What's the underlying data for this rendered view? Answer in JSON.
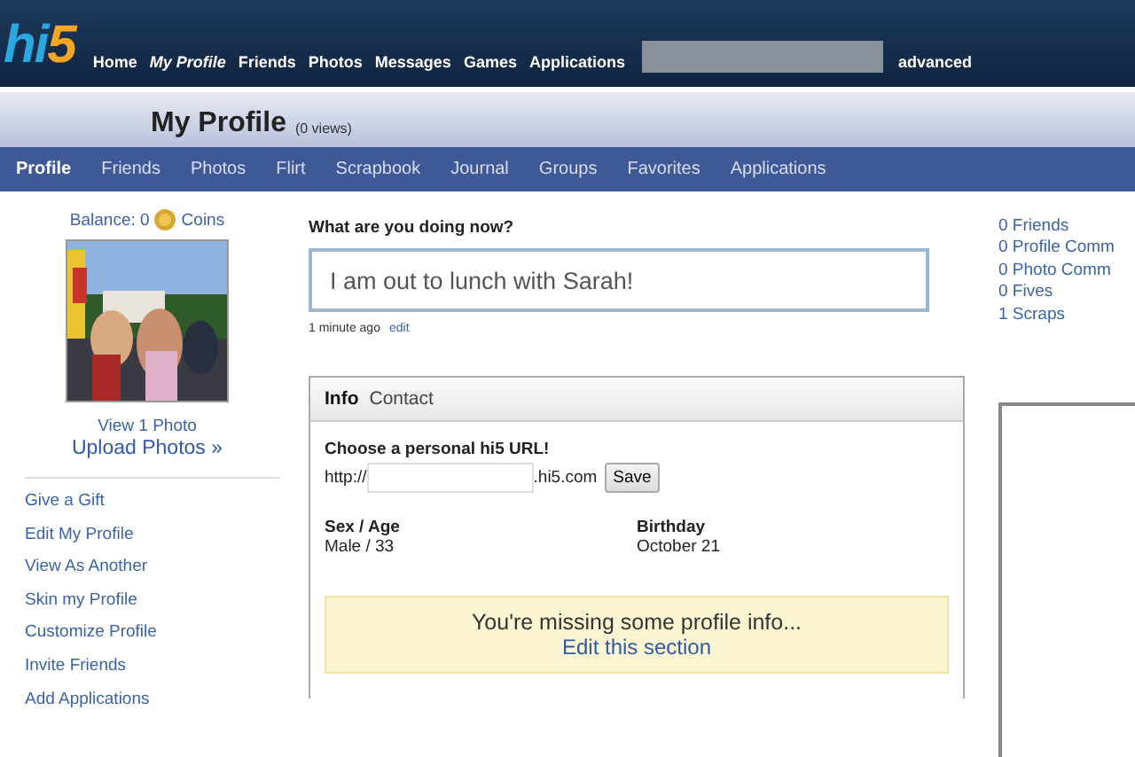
{
  "logo": {
    "part1": "hi",
    "part2": "5"
  },
  "top_nav": [
    {
      "label": "Home",
      "selected": false
    },
    {
      "label": "My Profile",
      "selected": true
    },
    {
      "label": "Friends",
      "selected": false
    },
    {
      "label": "Photos",
      "selected": false
    },
    {
      "label": "Messages",
      "selected": false
    },
    {
      "label": "Games",
      "selected": false
    },
    {
      "label": "Applications",
      "selected": false
    }
  ],
  "search": {
    "advanced": "advanced"
  },
  "header": {
    "title": "My Profile",
    "views": "(0 views)"
  },
  "profile_nav": [
    {
      "label": "Profile",
      "selected": true
    },
    {
      "label": "Friends",
      "selected": false
    },
    {
      "label": "Photos",
      "selected": false
    },
    {
      "label": "Flirt",
      "selected": false
    },
    {
      "label": "Scrapbook",
      "selected": false
    },
    {
      "label": "Journal",
      "selected": false
    },
    {
      "label": "Groups",
      "selected": false
    },
    {
      "label": "Favorites",
      "selected": false
    },
    {
      "label": "Applications",
      "selected": false
    }
  ],
  "sidebar": {
    "balance_label": "Balance: 0",
    "coins_label": "Coins",
    "view_photos": "View 1 Photo",
    "upload": "Upload Photos »",
    "links": [
      "Give a Gift",
      "Edit My Profile",
      "View As Another",
      "Skin my Profile",
      "Customize Profile",
      "Invite Friends",
      "Add Applications"
    ]
  },
  "status": {
    "question": "What are you doing now?",
    "value": "I am out to lunch with Sarah!",
    "time": "1 minute ago",
    "edit": "edit"
  },
  "info_panel": {
    "tabs": [
      {
        "label": "Info",
        "selected": true
      },
      {
        "label": "Contact",
        "selected": false
      }
    ],
    "url_heading": "Choose a personal hi5 URL!",
    "url_prefix": "http://",
    "url_suffix": ".hi5.com",
    "save": "Save",
    "fields": [
      {
        "label": "Sex /  Age",
        "value": "Male /  33"
      },
      {
        "label": "Birthday",
        "value": "October 21"
      }
    ],
    "notice": {
      "text": "You're missing some profile info...",
      "link": "Edit this section"
    }
  },
  "stats": [
    "0 Friends",
    "0 Profile Comm",
    "0 Photo Comm",
    "0 Fives",
    "1 Scraps"
  ]
}
